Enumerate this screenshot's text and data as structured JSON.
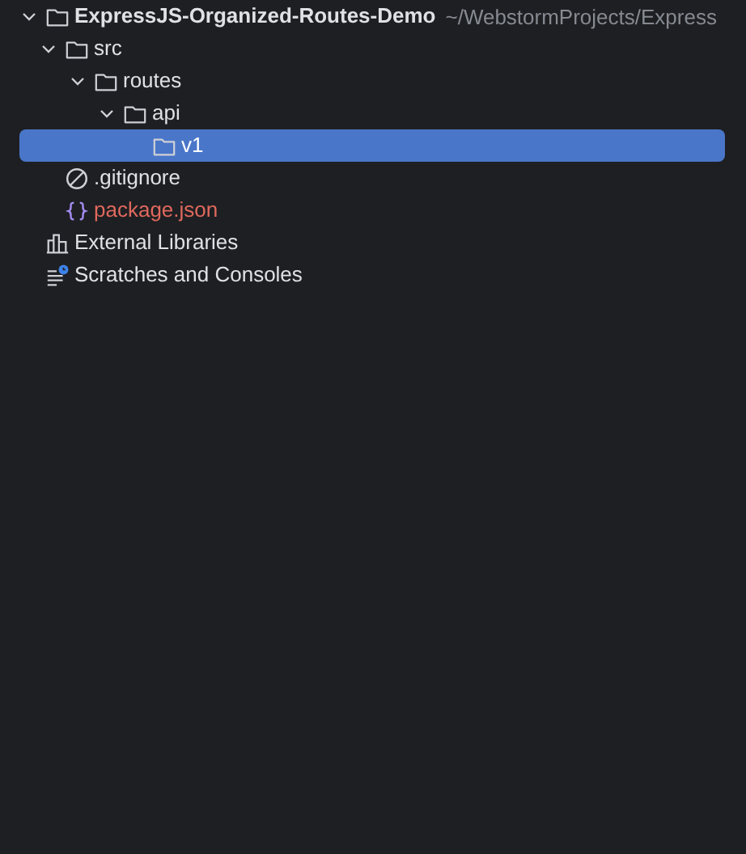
{
  "tree": [
    {
      "kind": "folder",
      "label": "ExpressJS-Organized-Routes-Demo",
      "path": "~/WebstormProjects/Express",
      "expanded": true,
      "selected": false,
      "children": [
        {
          "kind": "folder",
          "label": "src",
          "expanded": true,
          "selected": false,
          "children": [
            {
              "kind": "folder",
              "label": "routes",
              "expanded": true,
              "selected": false,
              "children": [
                {
                  "kind": "folder",
                  "label": "api",
                  "expanded": true,
                  "selected": false,
                  "children": [
                    {
                      "kind": "folder",
                      "label": "v1",
                      "selected": true
                    }
                  ]
                }
              ]
            }
          ]
        },
        {
          "kind": "ignore",
          "label": ".gitignore",
          "selected": false
        },
        {
          "kind": "json",
          "label": "package.json",
          "color": "#e0695d",
          "selected": false
        }
      ]
    },
    {
      "kind": "libraries",
      "label": "External Libraries",
      "selected": false
    },
    {
      "kind": "scratches",
      "label": "Scratches and Consoles",
      "selected": false
    }
  ]
}
